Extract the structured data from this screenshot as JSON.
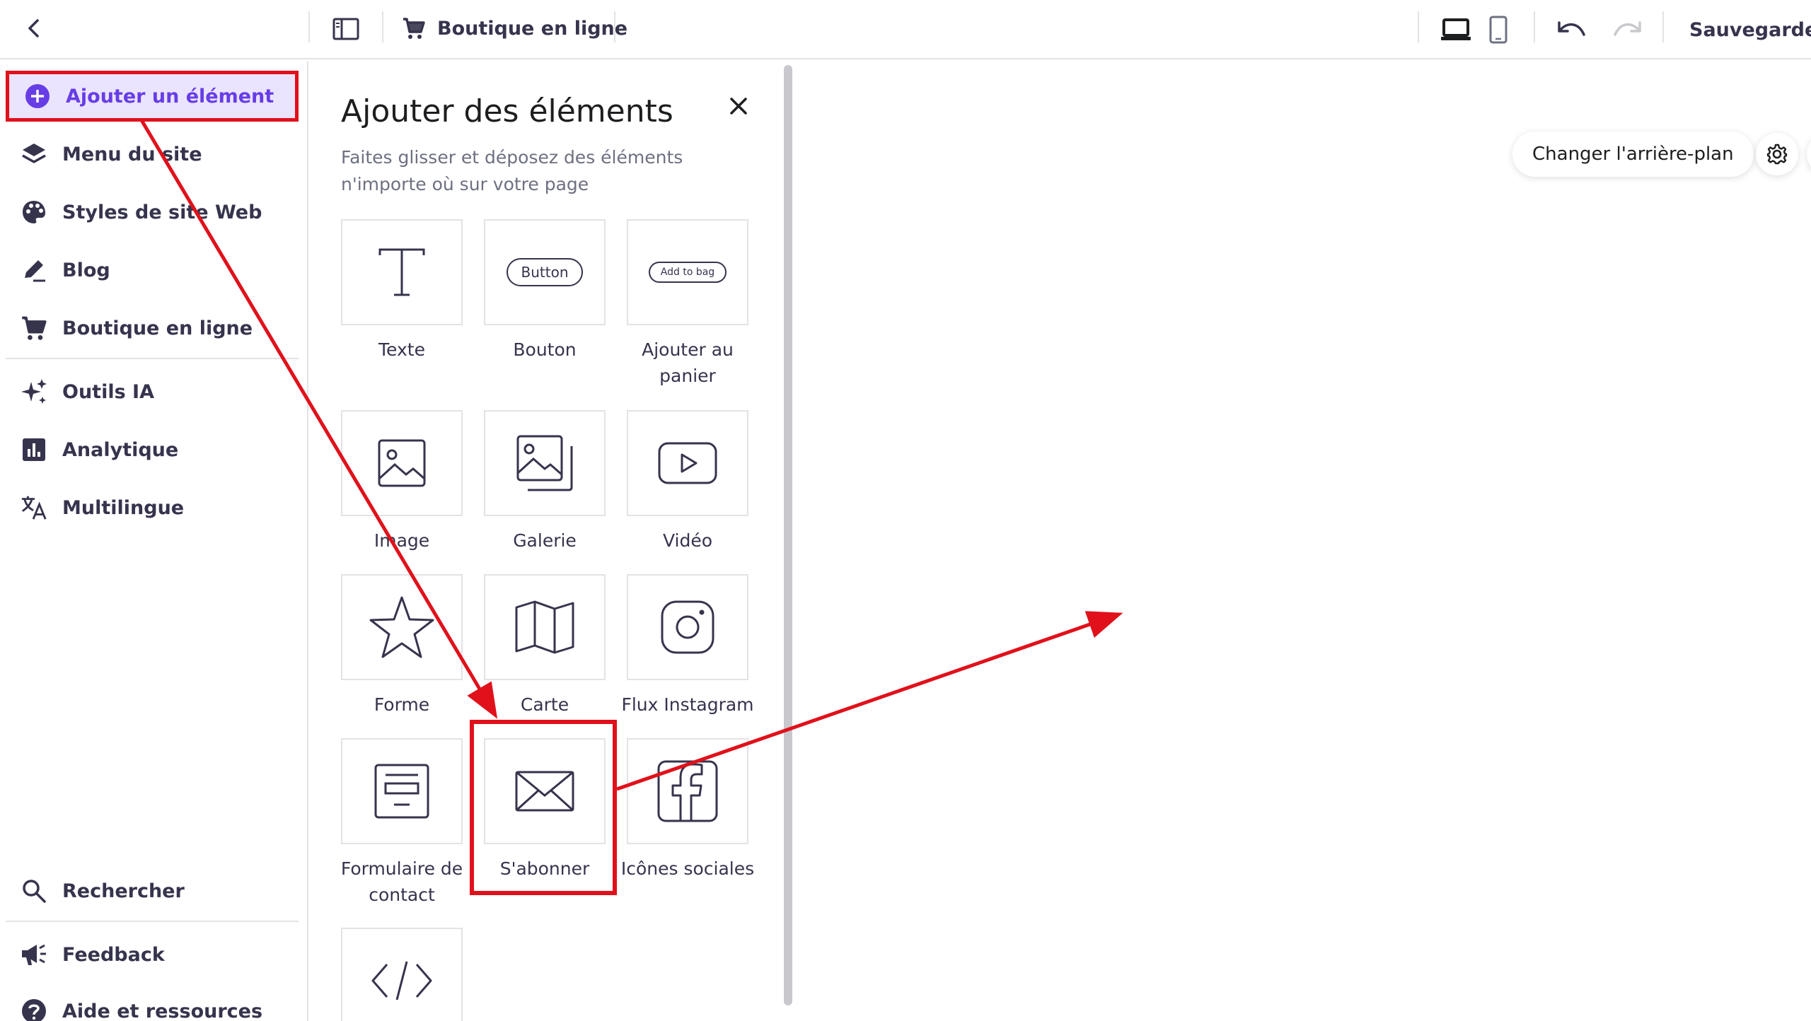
{
  "topbar": {
    "store_label": "Boutique en ligne",
    "save_label": "Sauvegarder"
  },
  "sidebar": {
    "items": [
      {
        "label": "Ajouter un élément",
        "icon": "plus-circle-icon"
      },
      {
        "label": "Menu du site",
        "icon": "layers-icon"
      },
      {
        "label": "Styles de site Web",
        "icon": "palette-icon"
      },
      {
        "label": "Blog",
        "icon": "pen-icon"
      },
      {
        "label": "Boutique en ligne",
        "icon": "cart-icon"
      },
      {
        "label": "Outils IA",
        "icon": "sparkles-icon"
      },
      {
        "label": "Analytique",
        "icon": "analytics-icon"
      },
      {
        "label": "Multilingue",
        "icon": "translate-icon"
      }
    ],
    "bottom": [
      {
        "label": "Rechercher",
        "icon": "search-icon"
      },
      {
        "label": "Feedback",
        "icon": "megaphone-icon"
      },
      {
        "label": "Aide et ressources",
        "icon": "help-icon"
      }
    ]
  },
  "panel": {
    "title": "Ajouter des éléments",
    "description": "Faites glisser et déposez des éléments n'importe où sur votre page",
    "tiles": [
      {
        "label": "Texte",
        "icon": "text-icon"
      },
      {
        "label": "Bouton",
        "icon": "button-icon",
        "preview": "Button"
      },
      {
        "label": "Ajouter au panier",
        "icon": "add-to-bag-icon",
        "preview": "Add to bag"
      },
      {
        "label": "Image",
        "icon": "image-icon"
      },
      {
        "label": "Galerie",
        "icon": "gallery-icon"
      },
      {
        "label": "Vidéo",
        "icon": "video-icon"
      },
      {
        "label": "Forme",
        "icon": "star-icon"
      },
      {
        "label": "Carte",
        "icon": "map-icon"
      },
      {
        "label": "Flux Instagram",
        "icon": "instagram-icon"
      },
      {
        "label": "Formulaire de contact",
        "icon": "form-icon"
      },
      {
        "label": "S'abonner",
        "icon": "envelope-icon"
      },
      {
        "label": "Icônes sociales",
        "icon": "facebook-icon"
      },
      {
        "label": "",
        "icon": "code-icon"
      }
    ]
  },
  "canvas": {
    "change_background_label": "Changer l'arrière-plan"
  },
  "colors": {
    "accent": "#673de6",
    "accent_bg": "#ebe4ff",
    "annotation_red": "#e0111b",
    "text_dark": "#36344d",
    "text_muted": "#6d7081",
    "border": "#e3e3e6"
  }
}
